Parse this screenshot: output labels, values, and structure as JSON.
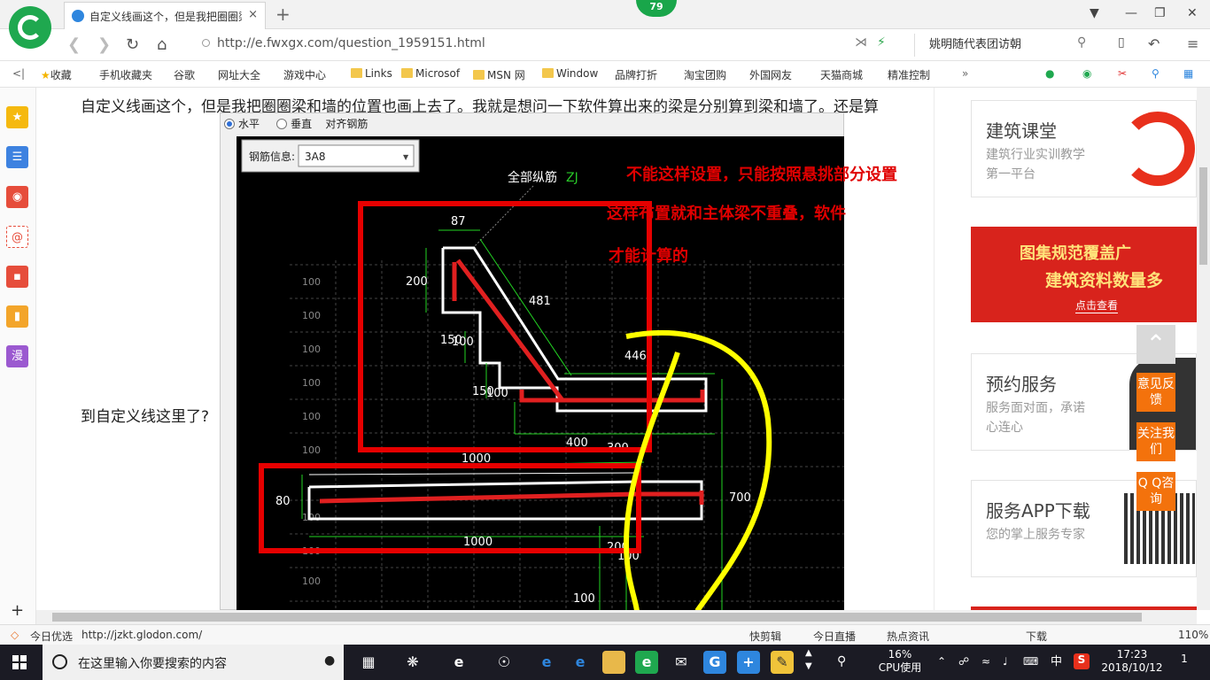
{
  "browser": {
    "tab_title": "自定义线画这个，但是我把圈圈梁",
    "tab_close": "×",
    "new_tab": "+",
    "badge": "79",
    "url": "http://e.fwxgx.com/question_1959151.html",
    "search_text": "姚明随代表团访朝",
    "status_url": "http://jzkt.glodon.com/",
    "status_left": "今日优选",
    "status_items": [
      "快剪辑",
      "今日直播",
      "热点资讯",
      "下载",
      "110%"
    ]
  },
  "bookmarks": [
    "收藏",
    "手机收藏夹",
    "谷歌",
    "网址大全",
    "游戏中心",
    "Links",
    "Microsof",
    "MSN 网",
    "Window",
    "品牌打折",
    "淘宝团购",
    "外国网友",
    "天猫商城",
    "精准控制"
  ],
  "sidebar": {
    "icons": [
      "star-icon",
      "news-icon",
      "weibo-icon",
      "mail-icon",
      "game-icon",
      "book-icon",
      "manga-icon"
    ],
    "manga_label": "漫",
    "add": "+"
  },
  "question": {
    "line1": "自定义线画这个，但是我把圈圈梁和墙的位置也画上去了。我就是想问一下软件算出来的梁是分别算到梁和墙了。还是算",
    "line2": "到自定义线这里了?"
  },
  "cad": {
    "radio_horizontal": "水平",
    "radio_vertical": "垂直",
    "align_label": "对齐钢筋",
    "rebar_info_label": "钢筋信息:",
    "rebar_info_value": "3A8",
    "all_rebar_label": "全部纵筋",
    "zj": "ZJ",
    "annotation_lines": [
      "不能这样设置，只能按照悬挑部分设置",
      "这样布置就和主体梁不重叠，软件",
      "才能计算的"
    ],
    "dims": [
      "87",
      "200",
      "481",
      "150",
      "100",
      "446",
      "150",
      "100",
      "400",
      "300",
      "1000",
      "80",
      "1000",
      "700",
      "200",
      "100",
      "100"
    ],
    "grid_labels": [
      "100",
      "100",
      "100",
      "100",
      "100",
      "100",
      "100",
      "100",
      "100",
      "100",
      "100",
      "100",
      "100",
      "100"
    ]
  },
  "right_panel": {
    "card1_title": "建筑课堂",
    "card1_sub": "建筑行业实训教学第一平台",
    "banner_line1": "图集规范覆盖广",
    "banner_line2": "建筑资料数量多",
    "banner_link": "点击查看",
    "card2_title": "预约服务",
    "card2_sub": "服务面对面，承诺心连心",
    "card3_title": "服务APP下载",
    "card3_sub": "您的掌上服务专家"
  },
  "float_buttons": [
    "意见反馈",
    "关注我们",
    "Q Q咨询"
  ],
  "taskbar": {
    "search_placeholder": "在这里输入你要搜索的内容",
    "cpu_label": "16%",
    "cpu_sub": "CPU使用",
    "ime": "中",
    "time": "17:23",
    "date": "2018/10/12",
    "notif": "1"
  }
}
